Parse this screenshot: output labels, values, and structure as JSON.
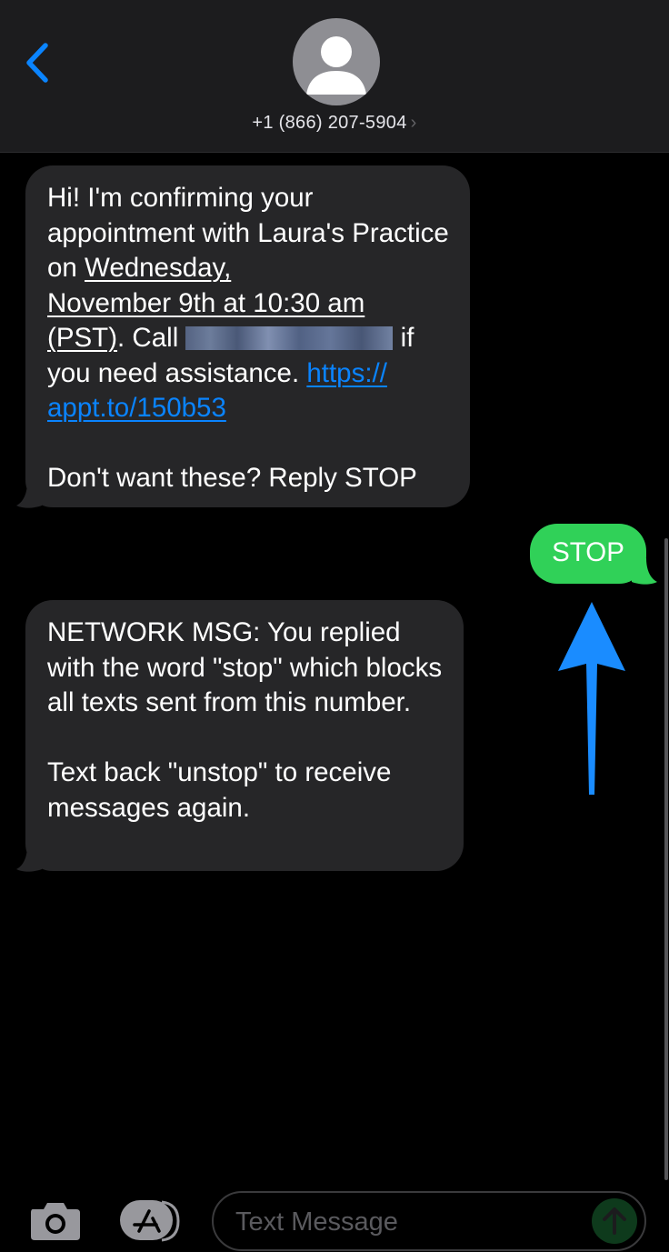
{
  "header": {
    "contact_name": "+1 (866) 207-5904",
    "contact_chevron": "›"
  },
  "messages": [
    {
      "direction": "incoming",
      "segments": {
        "s1": "Hi! I'm confirming your appointment with Laura's Practice on ",
        "s2": "Wednesday,",
        "s3": "November 9th at 10:30 am",
        "s4": "(PST)",
        "s5": ". Call ",
        "s6": " if you need assistance. ",
        "link_line1": "https://",
        "link_line2": "appt.to/150b53",
        "footer": "Don't want these? Reply STOP"
      }
    },
    {
      "direction": "outgoing",
      "text": "STOP"
    },
    {
      "direction": "incoming",
      "para1": "NETWORK MSG: You replied with the word \"stop\" which blocks all texts sent from this number.",
      "para2": "Text back \"unstop\" to receive messages again."
    }
  ],
  "compose": {
    "placeholder": "Text Message"
  },
  "icons": {
    "back": "chevron-left-icon",
    "avatar": "person-icon",
    "camera": "camera-icon",
    "apps": "app-store-icon",
    "send": "arrow-up-icon",
    "annotation": "arrow-up-annotation"
  },
  "colors": {
    "accent_blue": "#0a84ff",
    "outgoing_green": "#30d158",
    "incoming_bubble": "#262628",
    "annotation_blue": "#1a8cff"
  }
}
